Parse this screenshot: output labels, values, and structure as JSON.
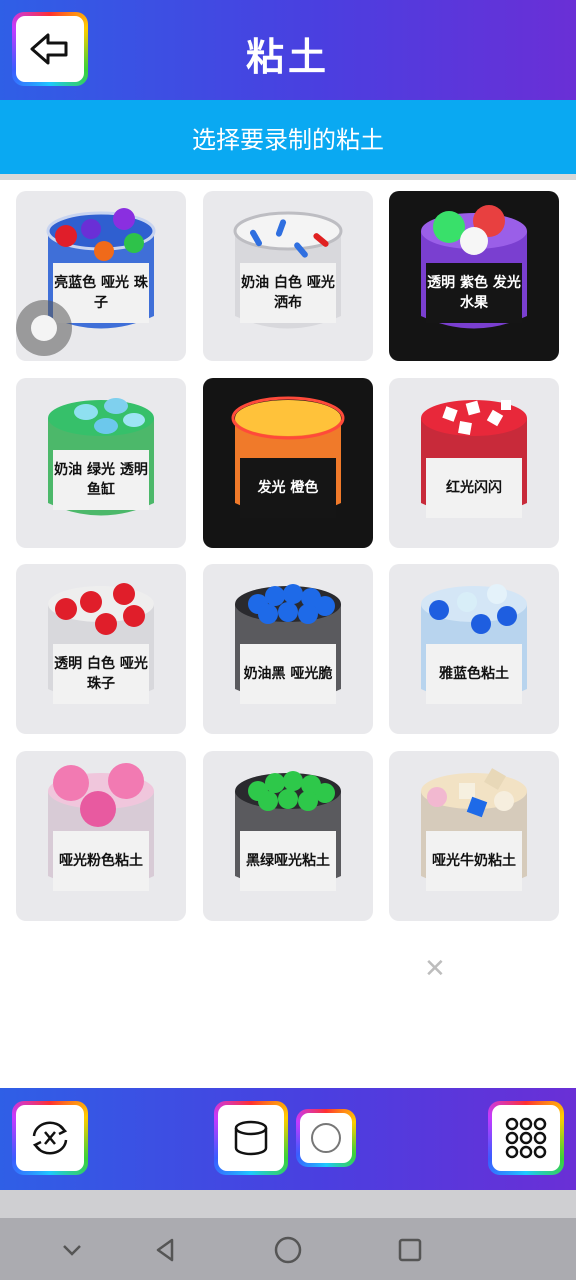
{
  "header": {
    "title": "粘土",
    "back_icon": "back-arrow-icon"
  },
  "subheader": {
    "text": "选择要录制的粘土"
  },
  "clays": [
    {
      "label": "亮蓝色 哑光 珠子"
    },
    {
      "label": "奶油 白色 哑光 洒布"
    },
    {
      "label": "透明 紫色 发光 水果"
    },
    {
      "label": "奶油 绿光 透明 鱼缸"
    },
    {
      "label": "发光 橙色"
    },
    {
      "label": "红光闪闪"
    },
    {
      "label": "透明 白色 哑光 珠子"
    },
    {
      "label": "奶油黑 哑光脆"
    },
    {
      "label": "雅蓝色粘土"
    },
    {
      "label": "哑光粉色粘土"
    },
    {
      "label": "黑绿哑光粘土"
    },
    {
      "label": "哑光牛奶粘土"
    }
  ],
  "bottom_toolbar": {
    "buttons": [
      "switch-camera-icon",
      "cylinder-icon",
      "circle-icon",
      "grid-icon"
    ]
  },
  "system_nav": {
    "buttons": [
      "collapse-icon",
      "back-icon",
      "home-icon",
      "recents-icon"
    ]
  }
}
